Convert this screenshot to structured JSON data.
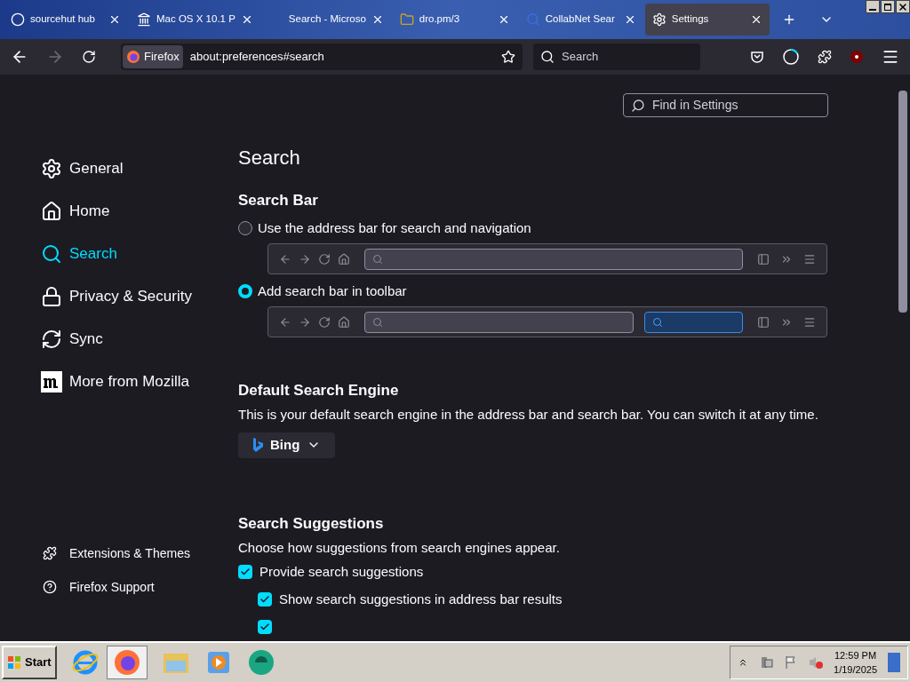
{
  "tabs": [
    {
      "title": "sourcehut hub",
      "kind": "circle",
      "selected": false
    },
    {
      "title": "Mac OS X 10.1 P",
      "kind": "building",
      "selected": false
    },
    {
      "title": "Search - Microso",
      "kind": "none",
      "selected": false
    },
    {
      "title": "dro.pm/3",
      "kind": "folder",
      "selected": false
    },
    {
      "title": "CollabNet Sear",
      "kind": "search",
      "selected": false
    },
    {
      "title": "Settings",
      "kind": "gear",
      "selected": true
    }
  ],
  "toolbar": {
    "identity": "Firefox",
    "url": "about:preferences#search",
    "search_placeholder": "Search"
  },
  "find_field": {
    "placeholder": "Find in Settings"
  },
  "sidebar": {
    "categories": [
      {
        "label": "General",
        "kind": "gear",
        "selected": false
      },
      {
        "label": "Home",
        "kind": "home",
        "selected": false
      },
      {
        "label": "Search",
        "kind": "search",
        "selected": true
      },
      {
        "label": "Privacy & Security",
        "kind": "lock",
        "selected": false
      },
      {
        "label": "Sync",
        "kind": "sync",
        "selected": false
      },
      {
        "label": "More from Mozilla",
        "kind": "mozilla",
        "selected": false
      }
    ],
    "footer_links": [
      {
        "label": "Extensions & Themes",
        "kind": "puzzle"
      },
      {
        "label": "Firefox Support",
        "kind": "help"
      }
    ]
  },
  "page": {
    "title": "Search",
    "search_bar": {
      "heading": "Search Bar",
      "options": [
        {
          "label": "Use the address bar for search and navigation",
          "kind": "address",
          "selected": false
        },
        {
          "label": "Add search bar in toolbar",
          "kind": "toolbar",
          "selected": true
        }
      ]
    },
    "default_engine": {
      "heading": "Default Search Engine",
      "description": "This is your default search engine in the address bar and search bar. You can switch it at any time.",
      "engine": "Bing"
    },
    "suggestions": {
      "heading": "Search Suggestions",
      "description": "Choose how suggestions from search engines appear.",
      "options": [
        {
          "label": "Provide search suggestions",
          "checked": true,
          "children": [
            {
              "label": "Show search suggestions in address bar results",
              "checked": true
            },
            {
              "checked": true
            }
          ]
        }
      ]
    }
  },
  "taskbar": {
    "start": "Start",
    "time": "12:59 PM",
    "date": "1/19/2025"
  }
}
